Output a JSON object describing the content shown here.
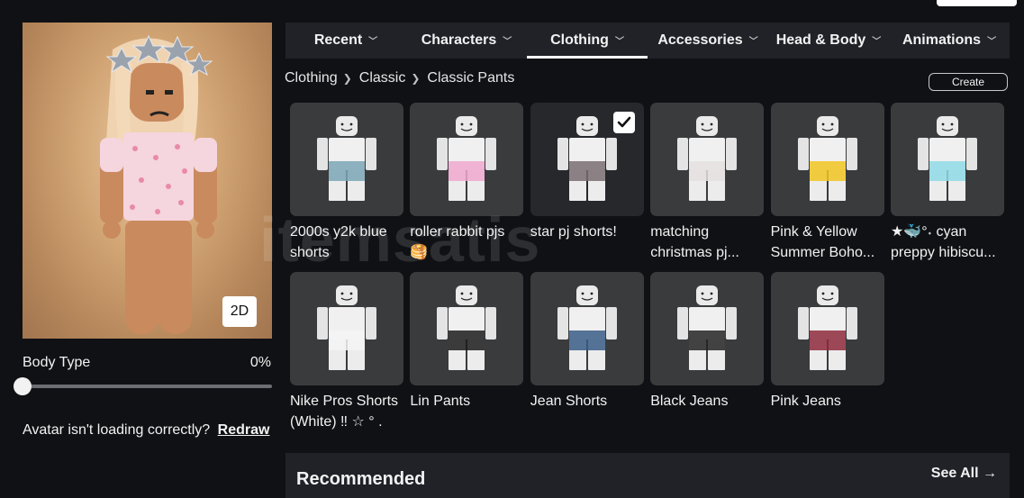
{
  "avatar": {
    "toggle_label": "2D",
    "body_type_label": "Body Type",
    "body_type_value": "0%",
    "body_type_fraction": 0.0,
    "loading_text": "Avatar isn't loading correctly?",
    "redraw_label": "Redraw"
  },
  "tabs": [
    {
      "label": "Recent",
      "active": false
    },
    {
      "label": "Characters",
      "active": false
    },
    {
      "label": "Clothing",
      "active": true
    },
    {
      "label": "Accessories",
      "active": false
    },
    {
      "label": "Head & Body",
      "active": false
    },
    {
      "label": "Animations",
      "active": false
    }
  ],
  "breadcrumb": [
    "Clothing",
    "Classic",
    "Classic Pants"
  ],
  "create_label": "Create",
  "items": [
    {
      "name": "2000s y2k blue shorts",
      "selected": false,
      "color": "#7ba6b5"
    },
    {
      "name": "roller rabbit pjs 🥞",
      "selected": false,
      "color": "#f0a8cf"
    },
    {
      "name": "star pj shorts!",
      "selected": true,
      "color": "#7a6d72"
    },
    {
      "name": "matching christmas pj...",
      "selected": false,
      "color": "#e5e0e0"
    },
    {
      "name": "Pink & Yellow Summer Boho...",
      "selected": false,
      "color": "#f2c521"
    },
    {
      "name": "★🐳°˖ cyan preppy hibiscu...",
      "selected": false,
      "color": "#8fdbe8"
    },
    {
      "name": "Nike Pros Shorts (White) ‼ ☆ ° .",
      "selected": false,
      "color": "#f4f4f4"
    },
    {
      "name": "Lin Pants",
      "selected": false,
      "color": "#1c1c1c"
    },
    {
      "name": "Jean Shorts",
      "selected": false,
      "color": "#3a5d86"
    },
    {
      "name": "Black Jeans",
      "selected": false,
      "color": "#242424"
    },
    {
      "name": "Pink Jeans",
      "selected": false,
      "color": "#8e2a3c"
    }
  ],
  "watermark": "itemsatis",
  "recommended": {
    "title": "Recommended",
    "see_all_label": "See All →"
  }
}
